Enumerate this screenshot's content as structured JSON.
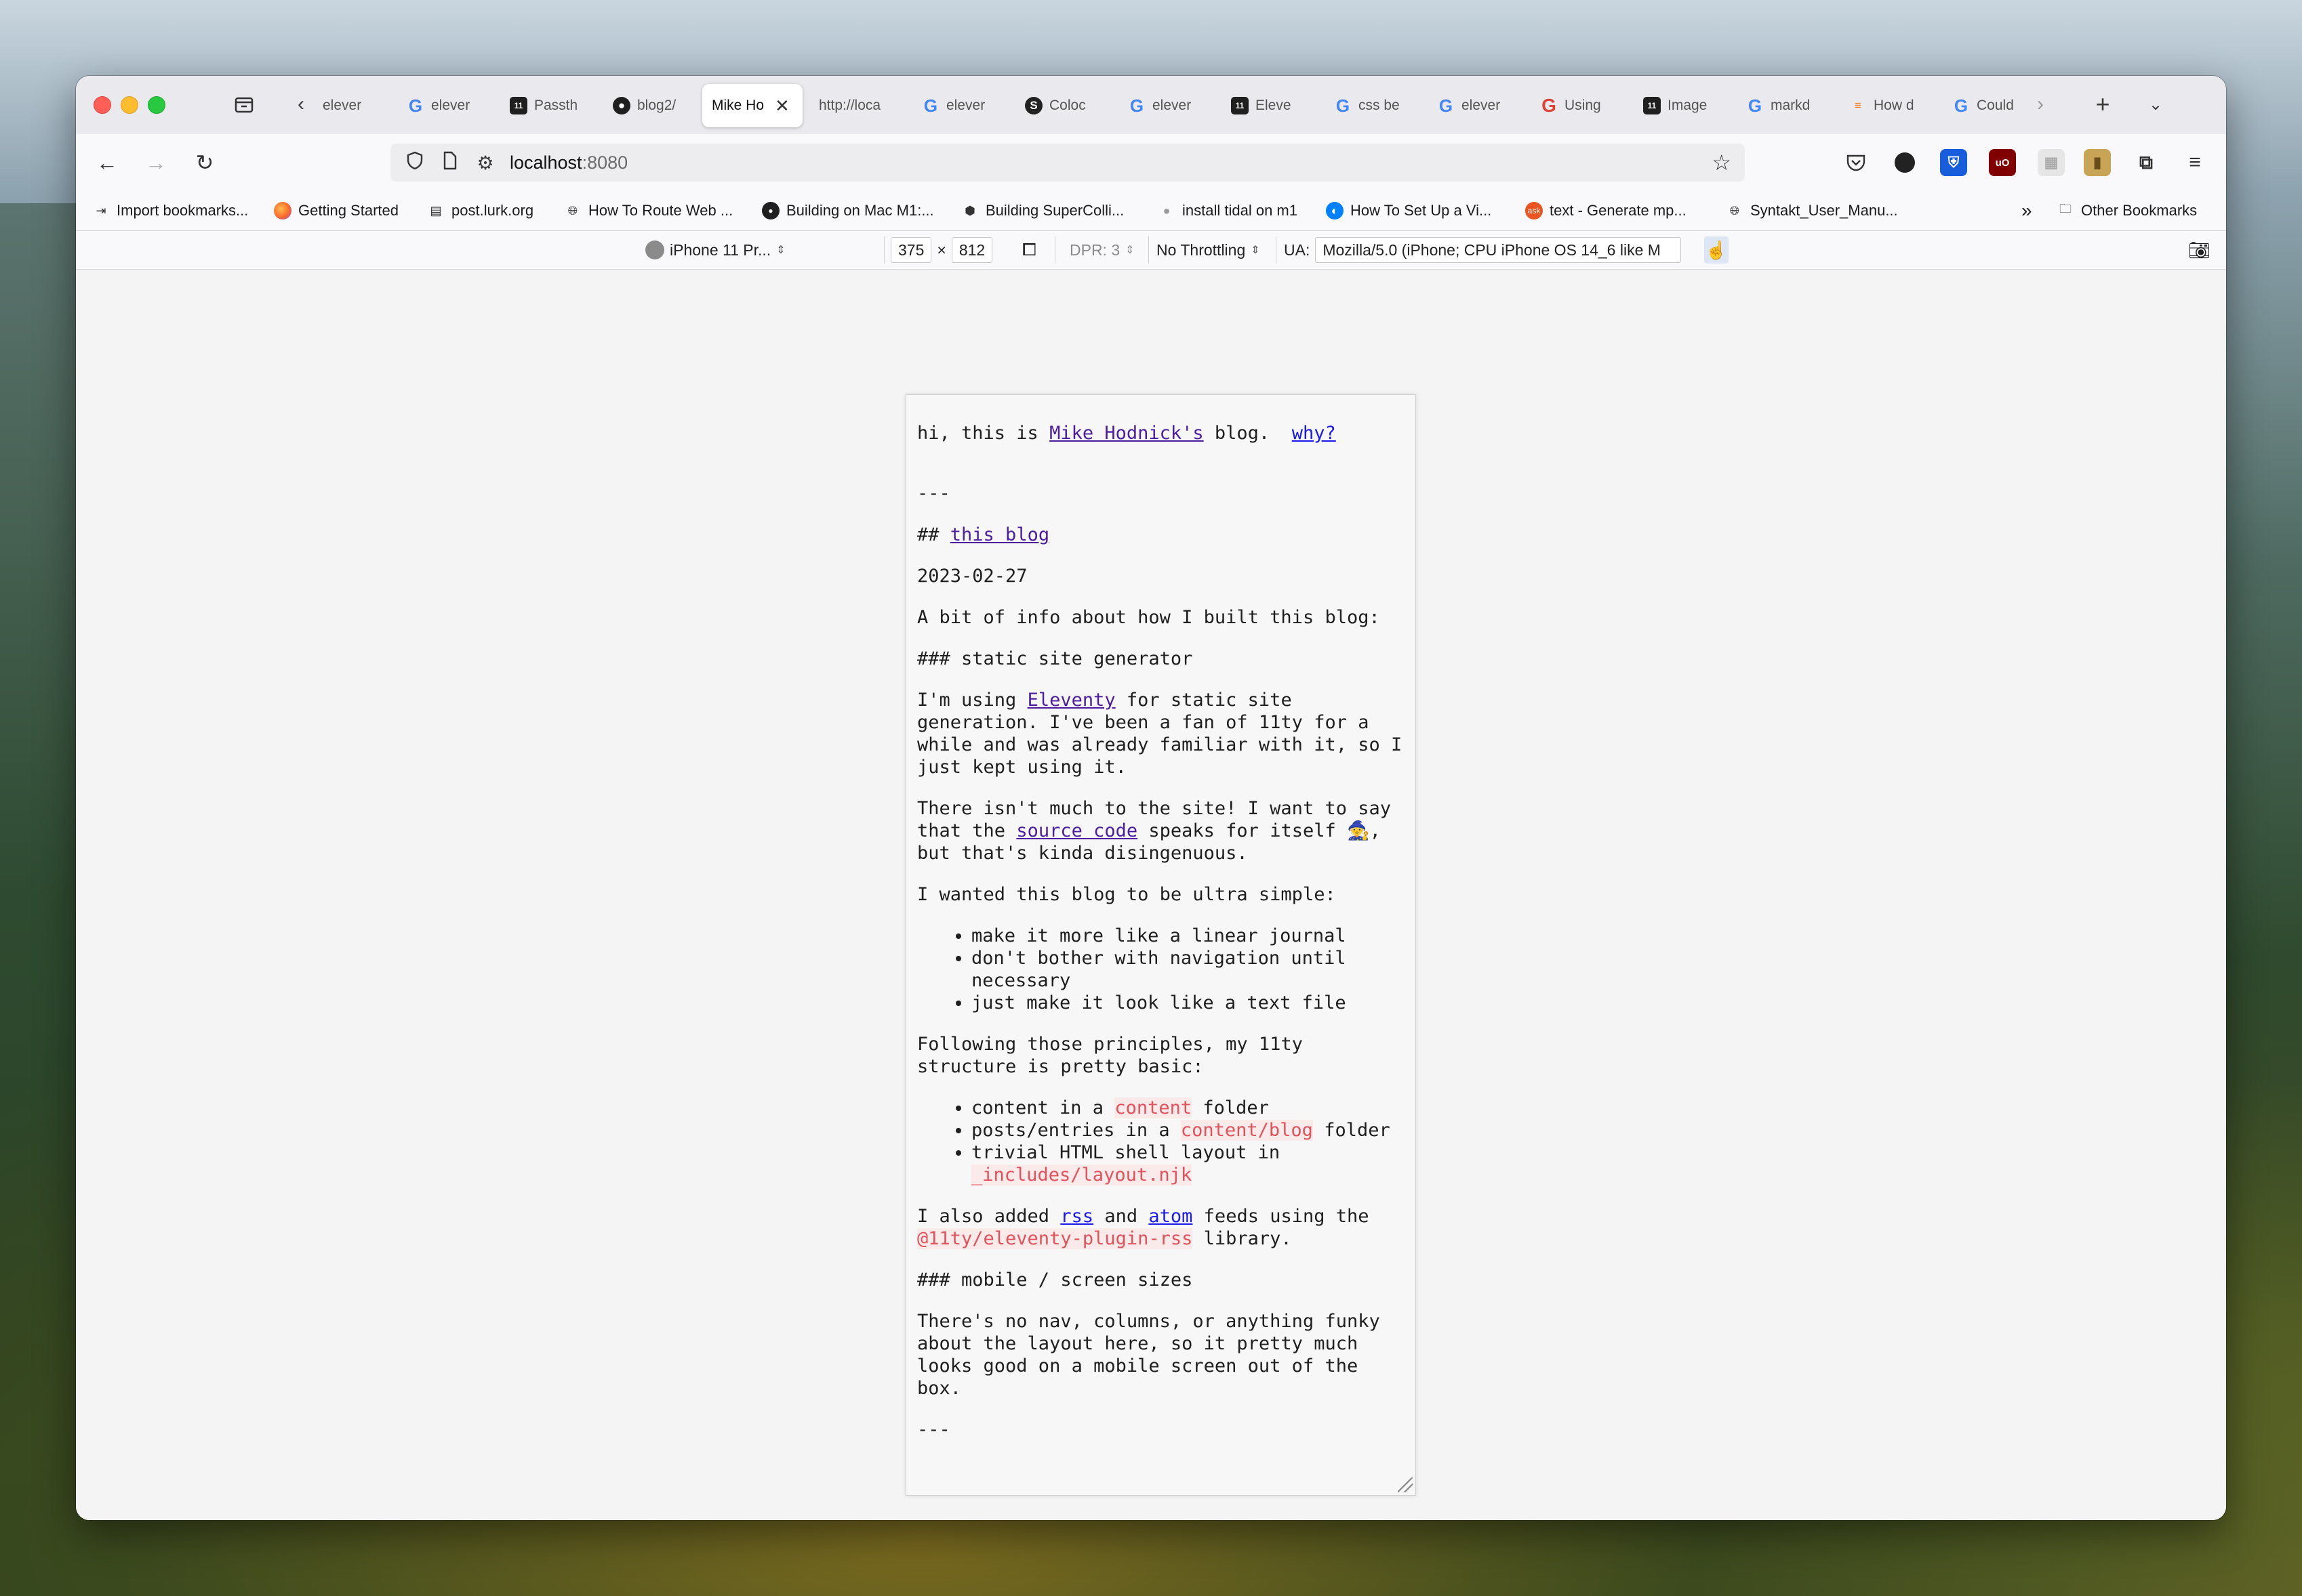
{
  "tabs": [
    {
      "title": "elever",
      "favicon": "none"
    },
    {
      "title": "elever",
      "favicon": "google"
    },
    {
      "title": "Passth",
      "favicon": "11ty"
    },
    {
      "title": "blog2/",
      "favicon": "github"
    },
    {
      "title": "Mike Ho",
      "favicon": "none",
      "active": true
    },
    {
      "title": "http://loca",
      "favicon": "none"
    },
    {
      "title": "elever",
      "favicon": "google"
    },
    {
      "title": "Coloc",
      "favicon": "s-circle"
    },
    {
      "title": "elever",
      "favicon": "google"
    },
    {
      "title": "Eleve",
      "favicon": "11ty"
    },
    {
      "title": "css be",
      "favicon": "google"
    },
    {
      "title": "elever",
      "favicon": "google"
    },
    {
      "title": "Using",
      "favicon": "google-red"
    },
    {
      "title": "Image",
      "favicon": "11ty"
    },
    {
      "title": "markd",
      "favicon": "google"
    },
    {
      "title": "How d",
      "favicon": "stackoverflow"
    },
    {
      "title": "Could",
      "favicon": "google"
    }
  ],
  "nav": {
    "url_host": "localhost",
    "url_port": ":8080"
  },
  "bookmarks": {
    "items": [
      {
        "label": "Import bookmarks...",
        "icon": "import-icon"
      },
      {
        "label": "Getting Started",
        "icon": "firefox-icon"
      },
      {
        "label": "post.lurk.org",
        "icon": "site-icon"
      },
      {
        "label": "How To Route Web ...",
        "icon": "globe-icon"
      },
      {
        "label": "Building on Mac M1:...",
        "icon": "github-icon"
      },
      {
        "label": "Building SuperColli...",
        "icon": "box-icon"
      },
      {
        "label": "install tidal on m1",
        "icon": "dot-icon"
      },
      {
        "label": "How To Set Up a Vi...",
        "icon": "digitalocean-icon"
      },
      {
        "label": "text - Generate mp...",
        "icon": "askubuntu-icon"
      },
      {
        "label": "Syntakt_User_Manu...",
        "icon": "globe-icon"
      }
    ],
    "other": "Other Bookmarks"
  },
  "rdm": {
    "device": "iPhone 11 Pr...",
    "width": "375",
    "times": "×",
    "height": "812",
    "dpr": "DPR: 3",
    "throttling": "No Throttling",
    "ua_label": "UA:",
    "ua_value": "Mozilla/5.0 (iPhone; CPU iPhone OS 14_6 like M"
  },
  "page": {
    "intro_prefix": "hi, this is ",
    "intro_link": "Mike Hodnick's",
    "intro_mid": " blog.  ",
    "why_link": "why?",
    "hr1": "---",
    "h2_prefix": "## ",
    "h2_link": "this blog",
    "date": "2023-02-27",
    "p_about": "A bit of info about how I built this blog:",
    "h3_ssg": "### static site generator",
    "p_eleventy_pre": "I'm using ",
    "p_eleventy_link": "Eleventy",
    "p_eleventy_post": " for static site generation. I've been a fan of 11ty for a while and was already familiar with it, so I just kept using it.",
    "p_site_pre": "There isn't much to the site! I want to say that the ",
    "p_site_link": "source code",
    "p_site_post": " speaks for itself 🧙, but that's kinda disingenuous.",
    "p_simple": "I wanted this blog to be ultra simple:",
    "list_simple": [
      "make it more like a linear journal",
      "don't bother with navigation until necessary",
      "just make it look like a text file"
    ],
    "p_principles": "Following those principles, my 11ty structure is pretty basic:",
    "li1_pre": "content in a ",
    "li1_code": "content",
    "li1_post": " folder",
    "li2_pre": "posts/entries in a ",
    "li2_code": "content/blog",
    "li2_post": " folder",
    "li3_pre": "trivial HTML shell layout in ",
    "li3_code": "_includes/layout.njk",
    "p_feeds_pre": "I also added ",
    "p_feeds_rss": "rss",
    "p_feeds_and": " and ",
    "p_feeds_atom": "atom",
    "p_feeds_mid": " feeds using the ",
    "p_feeds_code": "@11ty/eleventy-plugin-rss",
    "p_feeds_post": " library.",
    "h3_mobile": "### mobile / screen sizes",
    "p_mobile": "There's no nav, columns, or anything funky about the layout here, so it pretty much looks good on a mobile screen out of the box.",
    "hr2": "---"
  }
}
